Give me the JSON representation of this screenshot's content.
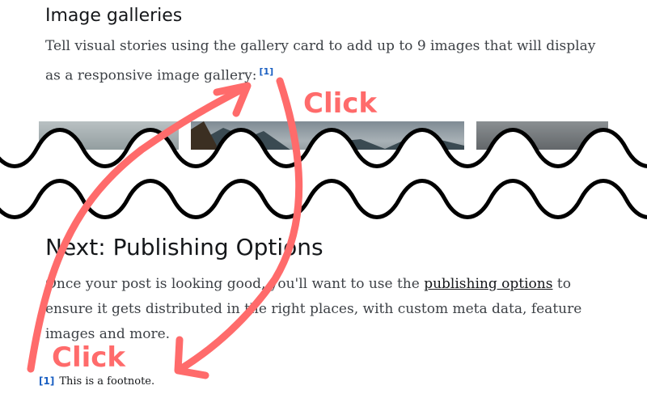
{
  "gallery_section": {
    "title": "Image galleries",
    "text": "Tell visual stories using the gallery card to add up to 9 images that will display as a responsive image gallery:",
    "footnote_ref": "[1]"
  },
  "next_section": {
    "title": "Next: Publishing Options",
    "text_before_link": "Once your post is looking good, you'll want to use the ",
    "link_text": "publishing options",
    "text_after_link": " to ensure it gets distributed in the right places, with custom meta data, feature images and more."
  },
  "footnote": {
    "marker": "[1]",
    "text": "This is a footnote."
  },
  "annotations": {
    "labels": [
      "Click",
      "Click"
    ],
    "color": "#ff6b6b"
  },
  "colors": {
    "link_blue": "#1a5fc2",
    "heading": "#15171a",
    "body_text": "#3d4146"
  }
}
